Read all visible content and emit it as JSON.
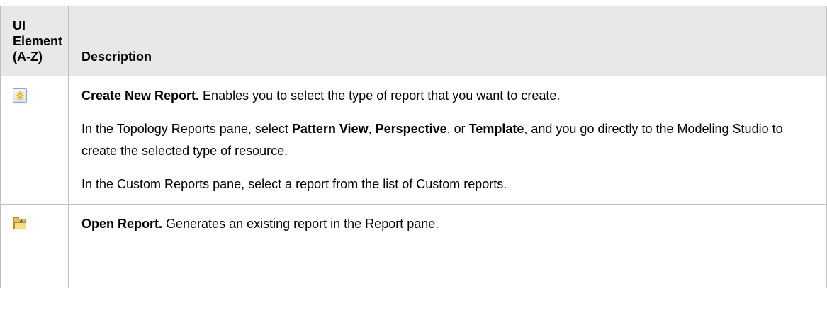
{
  "table": {
    "header": {
      "ui_element_lines": [
        "UI",
        "Element",
        "(A-Z)"
      ],
      "description": "Description"
    },
    "rows": [
      {
        "icon": "create-new-report-icon",
        "paragraphs": [
          {
            "segments": [
              {
                "text": "Create New Report.",
                "bold": true
              },
              {
                "text": " Enables you to select the type of report that you want to create.",
                "bold": false
              }
            ]
          },
          {
            "segments": [
              {
                "text": "In the Topology Reports pane, select ",
                "bold": false
              },
              {
                "text": "Pattern View",
                "bold": true
              },
              {
                "text": ", ",
                "bold": false
              },
              {
                "text": "Perspective",
                "bold": true
              },
              {
                "text": ", or ",
                "bold": false
              },
              {
                "text": "Template",
                "bold": true
              },
              {
                "text": ", and you go directly to the Modeling Studio to create the selected type of resource.",
                "bold": false
              }
            ]
          },
          {
            "segments": [
              {
                "text": "In the Custom Reports pane, select a report from the list of Custom reports.",
                "bold": false
              }
            ]
          }
        ]
      },
      {
        "icon": "open-report-icon",
        "paragraphs": [
          {
            "segments": [
              {
                "text": "Open Report.",
                "bold": true
              },
              {
                "text": " Generates an existing report in the Report pane.",
                "bold": false
              }
            ]
          }
        ]
      }
    ]
  },
  "colors": {
    "header_background": "#e8e8e8",
    "border": "#c0c0c0",
    "text": "#000000"
  }
}
